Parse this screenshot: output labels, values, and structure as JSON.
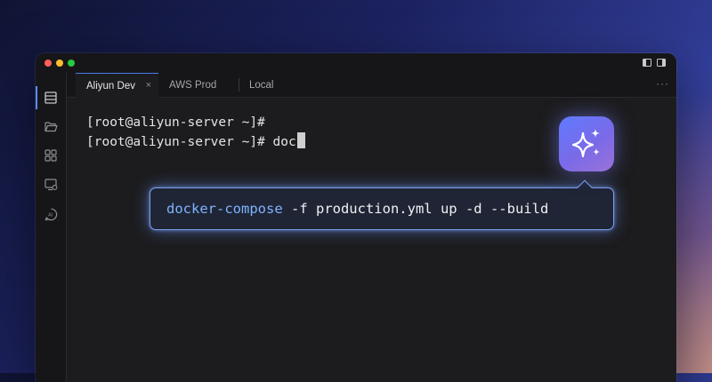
{
  "window": {
    "controls": [
      "close",
      "minimize",
      "maximize"
    ],
    "layout_icons": [
      "panel-left-icon",
      "panel-right-icon"
    ]
  },
  "sidebar": {
    "items": [
      {
        "name": "sessions-icon",
        "active": true
      },
      {
        "name": "folder-open-icon",
        "active": false
      },
      {
        "name": "grid-icon",
        "active": false
      },
      {
        "name": "monitor-settings-icon",
        "active": false
      },
      {
        "name": "ai-chat-icon",
        "active": false
      }
    ]
  },
  "tabs": [
    {
      "label": "Aliyun Dev",
      "active": true,
      "close": "×"
    },
    {
      "label": "AWS Prod",
      "active": false
    },
    {
      "label": "Local",
      "active": false
    }
  ],
  "more_label": "···",
  "terminal": {
    "lines": [
      "[root@aliyun-server ~]#",
      "[root@aliyun-server ~]# doc"
    ]
  },
  "suggestion": {
    "command": "docker-compose",
    "args": " -f production.yml up -d --build"
  },
  "ai_badge": {
    "icon": "sparkles-icon"
  },
  "colors": {
    "accent": "#5a8dff",
    "suggestion_border": "#7b9ff0",
    "command_highlight": "#7fb3ff",
    "badge_start": "#5f7bff",
    "badge_end": "#9a72d8"
  }
}
